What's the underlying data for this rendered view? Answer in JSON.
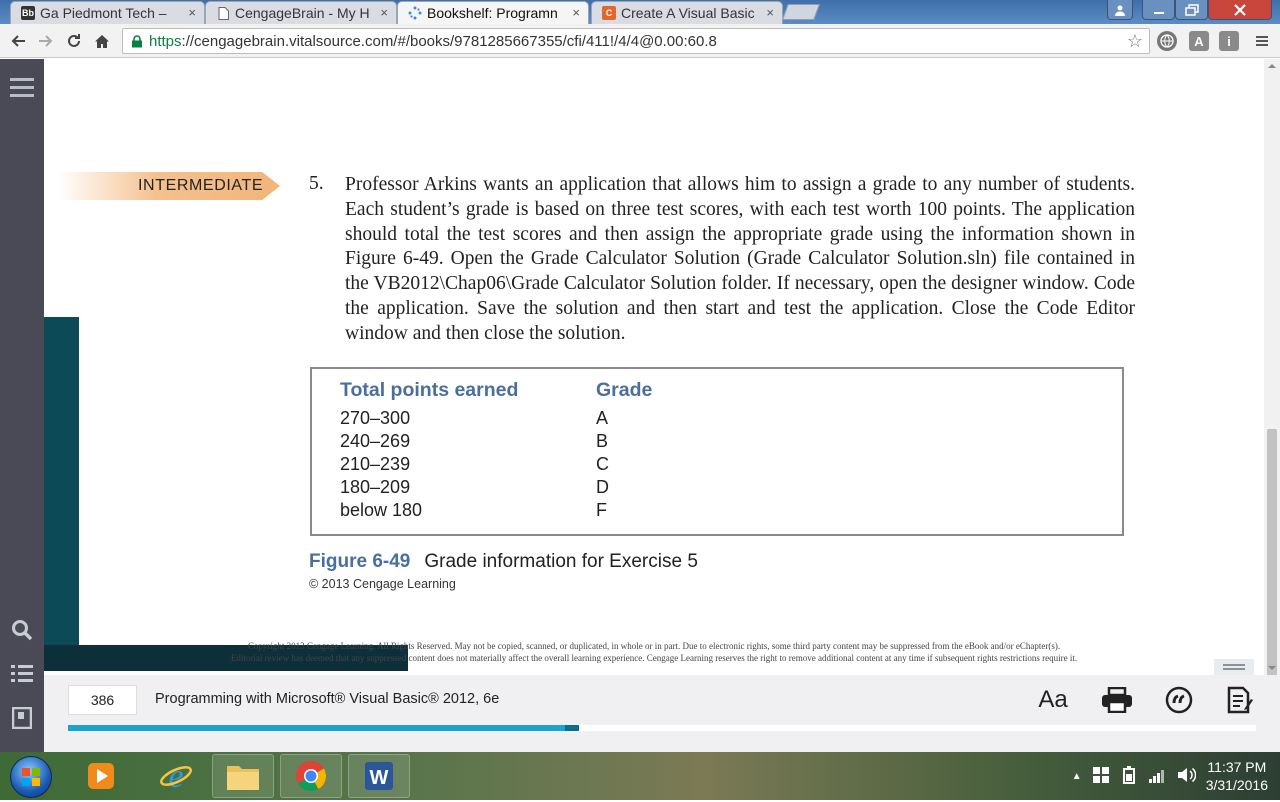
{
  "browser": {
    "tabs": [
      {
        "title": "Ga Piedmont Tech –",
        "favicon": "Bb",
        "favicon_name": "blackboard-icon"
      },
      {
        "title": "CengageBrain - My H",
        "favicon": "",
        "favicon_name": "document-icon"
      },
      {
        "title": "Bookshelf: Programn",
        "favicon": "",
        "favicon_name": "spinner-icon",
        "active": true
      },
      {
        "title": "Create A Visual Basic",
        "favicon": "C",
        "favicon_name": "cengage-icon"
      }
    ],
    "tab_close": "×",
    "url_scheme": "https",
    "url_rest": "://cengagebrain.vitalsource.com/#/books/9781285667355/cfi/411!/4/4@0.00:60.8",
    "extensions": [
      "A",
      "i"
    ]
  },
  "exercise": {
    "level": "INTERMEDIATE",
    "number": "5.",
    "text": "Professor Arkins wants an application that allows him to assign a grade to any number of students. Each student’s grade is based on three test scores, with each test worth 100 points. The application should total the test scores and then assign the appropriate grade using the information shown in Figure 6-49. Open the Grade Calculator Solution (Grade Calculator Solution.sln) file contained in the VB2012\\Chap06\\Grade Calculator Solution folder. If necessary, open the designer window. Code the application. Save the solution and then start and test the application. Close the Code Editor window and then close the solution."
  },
  "grade_table": {
    "headers": [
      "Total points earned",
      "Grade"
    ],
    "rows": [
      [
        "270–300",
        "A"
      ],
      [
        "240–269",
        "B"
      ],
      [
        "210–239",
        "C"
      ],
      [
        "180–209",
        "D"
      ],
      [
        "below 180",
        "F"
      ]
    ]
  },
  "figure": {
    "number": "Figure 6-49",
    "caption": "Grade information for Exercise 5",
    "copyright": "© 2013 Cengage Learning"
  },
  "legal": {
    "line1": "Copyright 2013 Cengage Learning. All Rights Reserved. May not be copied, scanned, or duplicated, in whole or in part. Due to electronic rights, some third party content may be suppressed from the eBook and/or eChapter(s).",
    "line2": "Editorial review has deemed that any suppressed content does not materially affect the overall learning experience. Cengage Learning reserves the right to remove additional content at any time if subsequent rights restrictions require it."
  },
  "reader": {
    "page_number": "386",
    "book_title": "Programming with Microsoft® Visual Basic® 2012, 6e",
    "progress": 0.43,
    "font_button": "Aa",
    "accent": "#1aa3d1"
  },
  "taskbar": {
    "time": "11:37 PM",
    "date": "3/31/2016"
  }
}
